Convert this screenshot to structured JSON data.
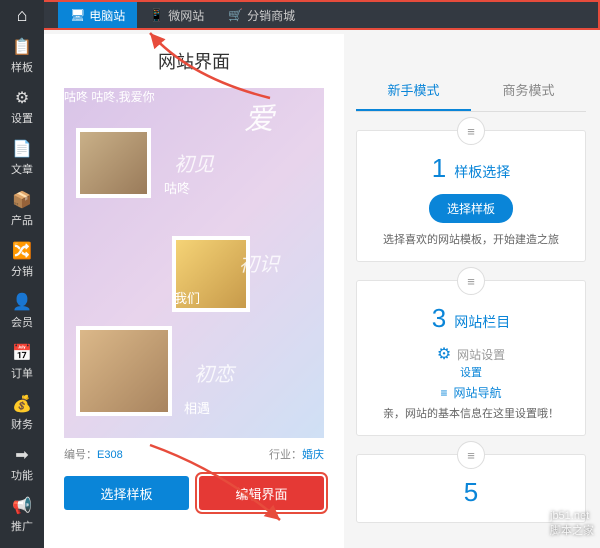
{
  "topbar": [
    {
      "icon": "🖥",
      "label": "电脑站",
      "active": true
    },
    {
      "icon": "📱",
      "label": "微网站",
      "active": false
    },
    {
      "icon": "🛒",
      "label": "分销商城",
      "active": false
    }
  ],
  "sidebar": [
    {
      "icon": "📋",
      "label": "样板"
    },
    {
      "icon": "⚙",
      "label": "设置"
    },
    {
      "icon": "📄",
      "label": "文章"
    },
    {
      "icon": "📦",
      "label": "产品"
    },
    {
      "icon": "🔀",
      "label": "分销"
    },
    {
      "icon": "👤",
      "label": "会员"
    },
    {
      "icon": "📅",
      "label": "订单"
    },
    {
      "icon": "💰",
      "label": "财务"
    },
    {
      "icon": "➡",
      "label": "功能"
    },
    {
      "icon": "📢",
      "label": "推广"
    }
  ],
  "main": {
    "title": "网站界面",
    "preview": {
      "slogan": "咕咚 咕咚,我爱你",
      "love": "爱",
      "meet": "初见",
      "gudo": "咕咚",
      "know": "初识",
      "us": "我们",
      "first": "初恋",
      "see": "相遇"
    },
    "meta": {
      "code_label": "编号：",
      "code_value": "E308",
      "cat_label": "行业：",
      "cat_value": "婚庆"
    },
    "btn_select": "选择样板",
    "btn_edit": "编辑界面"
  },
  "tabs": {
    "novice": "新手模式",
    "business": "商务模式"
  },
  "cards": {
    "c1": {
      "num": "1",
      "title": "样板选择",
      "btn": "选择样板",
      "tip": "选择喜欢的网站模板，开始建造之旅"
    },
    "c3": {
      "num": "3",
      "title": "网站栏目",
      "row1": "网站设置",
      "row1_icon": "⚙",
      "row1_label": "设置",
      "row2": "网站导航",
      "row2_icon": "≡",
      "tip": "亲，网站的基本信息在这里设置哦！"
    },
    "c5": {
      "num": "5"
    }
  },
  "watermark": {
    "url": "jb51.net",
    "name": "脚本之家"
  }
}
